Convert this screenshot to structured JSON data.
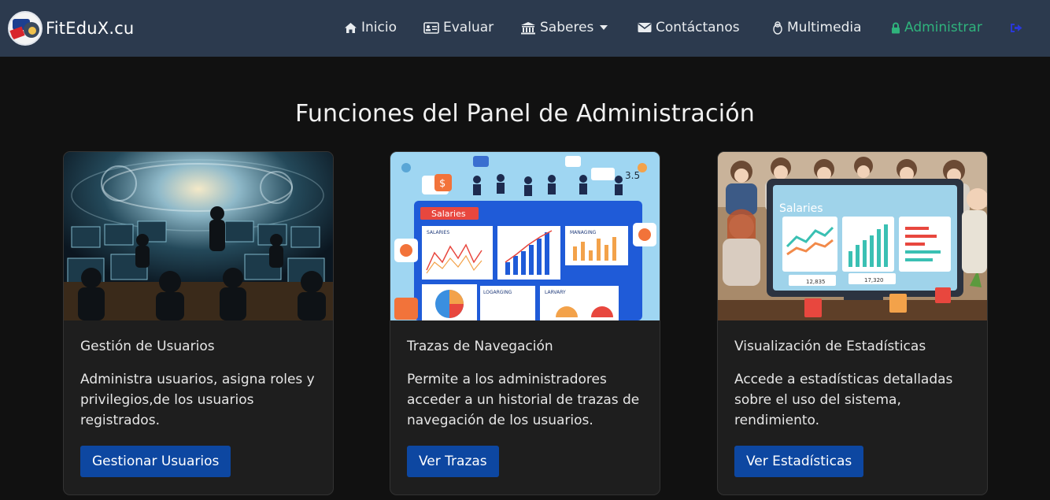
{
  "brand": {
    "name": "FitEduX.cu"
  },
  "nav": {
    "items": [
      {
        "label": "Inicio",
        "icon": "home-icon"
      },
      {
        "label": "Evaluar",
        "icon": "id-card-icon"
      },
      {
        "label": "Saberes",
        "icon": "bank-icon",
        "dropdown": true
      },
      {
        "label": "Contáctanos",
        "icon": "envelope-icon"
      },
      {
        "label": "Multimedia",
        "icon": "linux-penguin-icon"
      },
      {
        "label": "Administrar",
        "icon": "lock-icon",
        "active": true
      }
    ],
    "logout_icon": "sign-out-icon"
  },
  "colors": {
    "navbar": "#2c3a4e",
    "active": "#2fb37c",
    "button": "#0d47a1",
    "background": "#111111",
    "card": "#1e1e1e"
  },
  "page": {
    "title": "Funciones del Panel de Administración"
  },
  "cards": [
    {
      "title": "Gestión de Usuarios",
      "text": "Administra usuarios, asigna roles y privilegios,de los usuarios registrados.",
      "button": "Gestionar Usuarios"
    },
    {
      "title": "Trazas de Navegación",
      "text": "Permite a los administradores acceder a un historial de trazas de navegación de los usuarios.",
      "button": "Ver Trazas"
    },
    {
      "title": "Visualización de Estadísticas",
      "text": "Accede a estadísticas detalladas sobre el uso del sistema, rendimiento.",
      "button": "Ver Estadísticas"
    }
  ],
  "images": {
    "card2": {
      "banner": "Salaries",
      "labels": [
        "SALARIES",
        "MANAGING",
        "LOGARGING",
        "LARVARY"
      ],
      "badge": "3.5"
    },
    "card3": {
      "banner": "Salaries",
      "values": [
        "12,835",
        "17,320"
      ]
    }
  }
}
